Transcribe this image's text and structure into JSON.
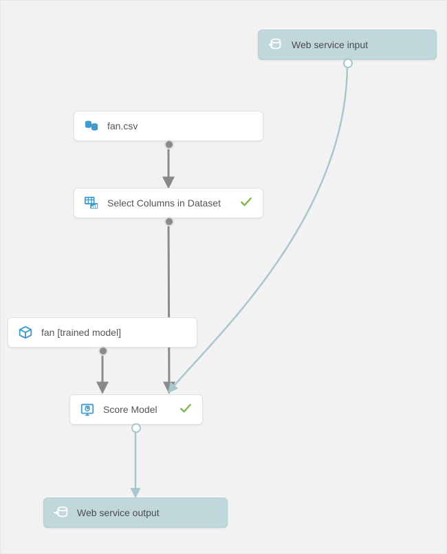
{
  "colors": {
    "canvas_bg": "#f2f2f2",
    "node_bg": "#ffffff",
    "node_border": "#e2e2e2",
    "ws_bg": "#c0d8dc",
    "ws_border": "#b3cfd3",
    "icon_blue": "#3e9bcc",
    "check_green": "#84b84c",
    "connector_gray": "#8a8a8a",
    "connector_ws": "#a6c7cc"
  },
  "nodes": {
    "ws_input": {
      "label": "Web service input",
      "icon": "web-service-in-icon",
      "status": null
    },
    "dataset": {
      "label": "fan.csv",
      "icon": "dataset-icon",
      "status": null
    },
    "select_cols": {
      "label": "Select Columns in Dataset",
      "icon": "select-columns-icon",
      "status": "ok"
    },
    "trained": {
      "label": "fan [trained model]",
      "icon": "trained-model-icon",
      "status": null
    },
    "score": {
      "label": "Score Model",
      "icon": "score-model-icon",
      "status": "ok"
    },
    "ws_output": {
      "label": "Web service output",
      "icon": "web-service-out-icon",
      "status": null
    }
  },
  "connections": [
    {
      "from": "dataset",
      "to": "select_cols",
      "kind": "data"
    },
    {
      "from": "select_cols",
      "to": "score",
      "kind": "data"
    },
    {
      "from": "trained",
      "to": "score",
      "kind": "data"
    },
    {
      "from": "ws_input",
      "to": "score",
      "kind": "ws"
    },
    {
      "from": "score",
      "to": "ws_output",
      "kind": "ws"
    }
  ]
}
